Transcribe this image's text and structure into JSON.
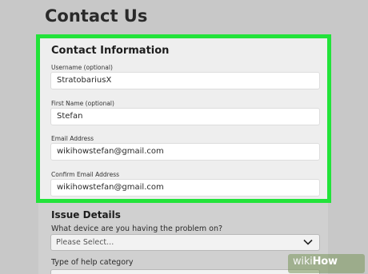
{
  "page": {
    "title": "Contact Us"
  },
  "contact_info": {
    "title": "Contact Information",
    "highlight_color": "#22e33a",
    "fields": [
      {
        "label": "Username (optional)",
        "value": "StratobariusX"
      },
      {
        "label": "First Name (optional)",
        "value": "Stefan"
      },
      {
        "label": "Email Address",
        "value": "wikihowstefan@gmail.com"
      },
      {
        "label": "Confirm Email Address",
        "value": "wikihowstefan@gmail.com"
      }
    ]
  },
  "issue_details": {
    "title": "Issue Details",
    "device_question": "What device are you having the problem on?",
    "device_select": {
      "value": "Please Select...",
      "icon": "chevron-down-icon"
    },
    "category_question": "Type of help category"
  },
  "watermark": {
    "prefix": "wiki",
    "suffix": "How"
  }
}
